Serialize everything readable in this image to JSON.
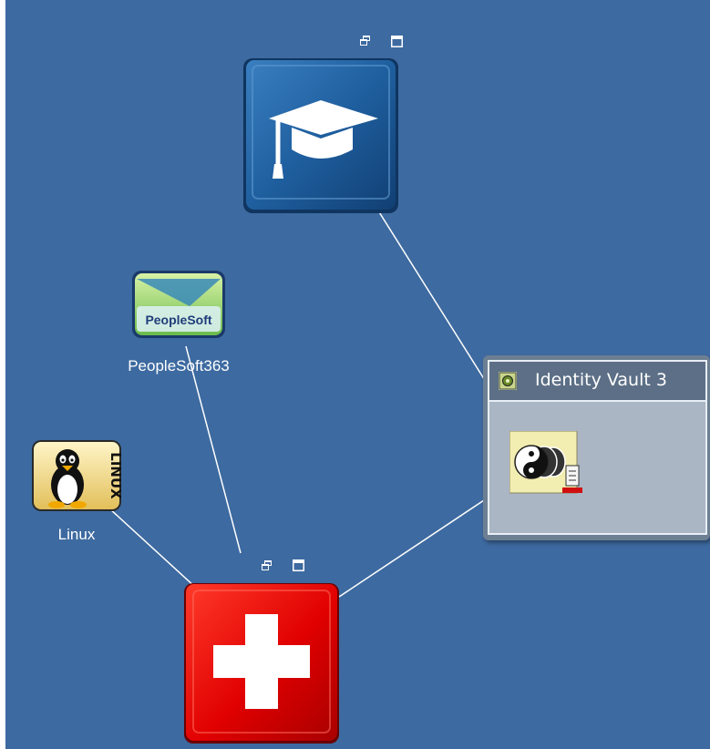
{
  "nodes": {
    "education": {
      "icon": "graduation-cap-icon"
    },
    "peoplesoft": {
      "label": "PeopleSoft363",
      "logo_text": "PeopleSoft"
    },
    "linux": {
      "label": "Linux",
      "logo_text": "LINUX"
    },
    "health": {
      "icon": "red-cross-icon"
    }
  },
  "vault": {
    "title": "Identity Vault 3",
    "icon": "identity-vault-icon",
    "driver_icon": "driver-set-icon"
  },
  "colors": {
    "canvas": "#3d6aa0",
    "link": "#ffffff",
    "accent_red": "#e00000",
    "accent_blue": "#1d5a9a"
  }
}
